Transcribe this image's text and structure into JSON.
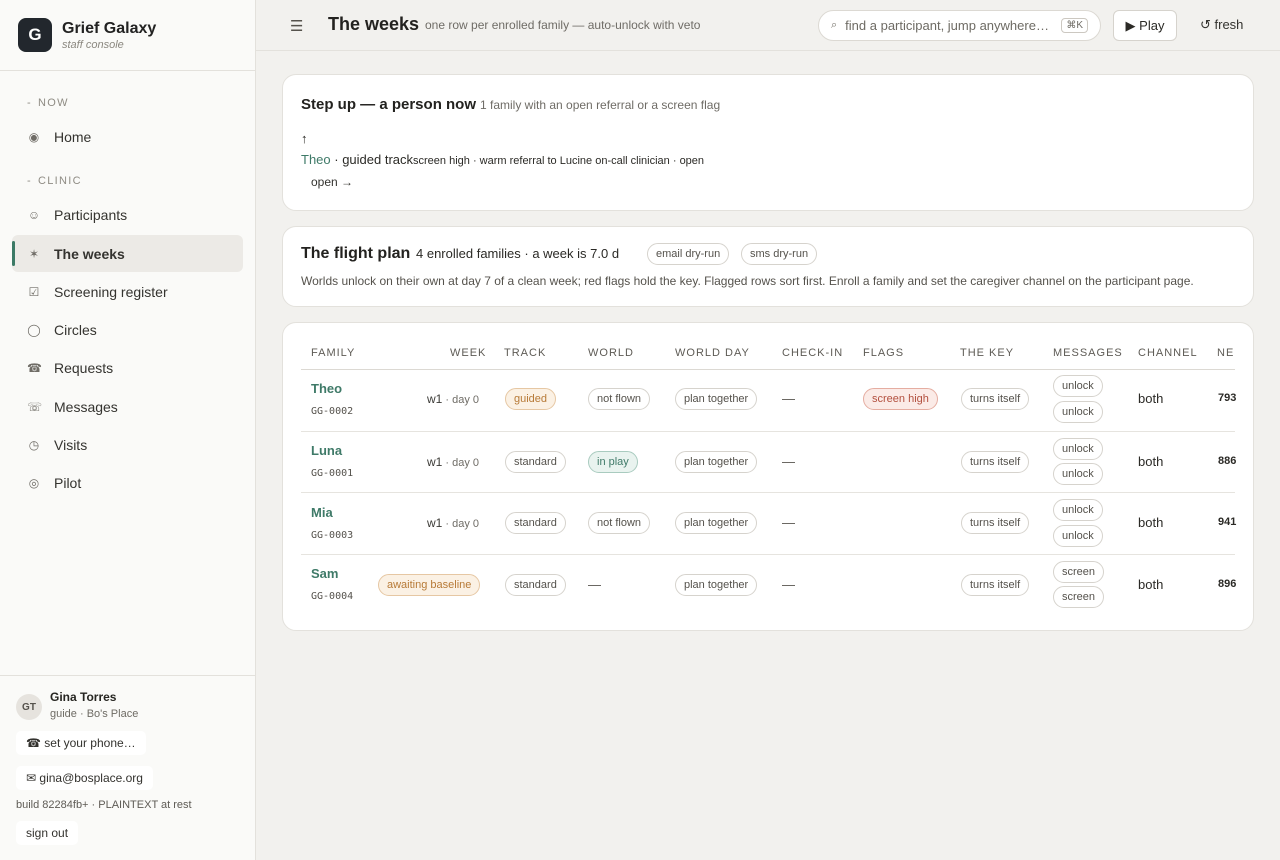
{
  "brand": {
    "logo": "G",
    "name": "Grief Galaxy",
    "sub": "staff console"
  },
  "nav": {
    "sections": [
      {
        "label": "NOW"
      },
      {
        "label": "CLINIC"
      }
    ],
    "items": [
      {
        "label": "Home",
        "icon": "◉"
      },
      {
        "label": "Participants",
        "icon": "☺"
      },
      {
        "label": "The weeks",
        "icon": "✶"
      },
      {
        "label": "Screening register",
        "icon": "☑"
      },
      {
        "label": "Circles",
        "icon": "◯"
      },
      {
        "label": "Requests",
        "icon": "☎"
      },
      {
        "label": "Messages",
        "icon": "☏"
      },
      {
        "label": "Visits",
        "icon": "◷"
      },
      {
        "label": "Pilot",
        "icon": "◎"
      }
    ]
  },
  "user": {
    "initials": "GT",
    "name": "Gina Torres",
    "role": "guide · Bo's Place",
    "phone_btn": "☎ set your phone…",
    "email_btn": "✉ gina@bosplace.org",
    "build": "build 82284fb+ · PLAINTEXT at rest",
    "signout": "sign out"
  },
  "topbar": {
    "menu_icon": "☰",
    "title": "The weeks",
    "subtitle": "one row per enrolled family — auto-unlock with veto",
    "search_icon": "⌕",
    "search_placeholder": "find a participant, jump anywhere…",
    "shortcut": "⌘K",
    "play": "▶ Play",
    "fresh": "↺ fresh"
  },
  "stepup": {
    "title": "Step up — a person now",
    "subtitle": "1 family with an open referral or a screen flag",
    "arrow": "↑",
    "name": "Theo",
    "track": " · guided track",
    "detail": "screen high · warm referral to Lucine on-call clinician · open",
    "open": "open →"
  },
  "flight": {
    "title": "The flight plan",
    "summary": "4 enrolled families · a week is 7.0 d",
    "pills": [
      "email dry-run",
      "sms dry-run"
    ],
    "note": "Worlds unlock on their own at day 7 of a clean week; red flags hold the key. Flagged rows sort first. Enroll a family and set the caregiver channel on the participant page."
  },
  "table": {
    "headers": {
      "family": "FAMILY",
      "week": "WEEK",
      "track": "TRACK",
      "world": "WORLD",
      "world_day": "WORLD DAY",
      "checkin": "CHECK-IN",
      "flags": "FLAGS",
      "key": "THE KEY",
      "messages": "MESSAGES",
      "channel": "CHANNEL",
      "next": "NE"
    },
    "rows": [
      {
        "name": "Theo",
        "id": "GG-0002",
        "week": "w1",
        "day": " · day 0",
        "track": "guided",
        "world": "not flown",
        "world_day": "plan together",
        "checkin": "—",
        "flag": "screen high",
        "key": "turns itself",
        "msg1": "unlock",
        "msg2": "unlock",
        "channel": "both",
        "next": "793"
      },
      {
        "name": "Luna",
        "id": "GG-0001",
        "week": "w1",
        "day": " · day 0",
        "track": "standard",
        "world": "in play",
        "world_day": "plan together",
        "checkin": "—",
        "flag": "",
        "key": "turns itself",
        "msg1": "unlock",
        "msg2": "unlock",
        "channel": "both",
        "next": "886"
      },
      {
        "name": "Mia",
        "id": "GG-0003",
        "week": "w1",
        "day": " · day 0",
        "track": "standard",
        "world": "not flown",
        "world_day": "plan together",
        "checkin": "—",
        "flag": "",
        "key": "turns itself",
        "msg1": "unlock",
        "msg2": "unlock",
        "channel": "both",
        "next": "941"
      },
      {
        "name": "Sam",
        "id": "GG-0004",
        "week_badge": "awaiting baseline",
        "track": "standard",
        "world": "—",
        "world_day": "plan together",
        "checkin": "—",
        "flag": "",
        "key": "turns itself",
        "msg1": "screen",
        "msg2": "screen",
        "channel": "both",
        "next": "896"
      }
    ]
  },
  "colors": {
    "accent": "#3c7a66",
    "brand_dark": "#22272d",
    "flag_red": "#b3503f",
    "badge_orange": "#b77a37"
  }
}
